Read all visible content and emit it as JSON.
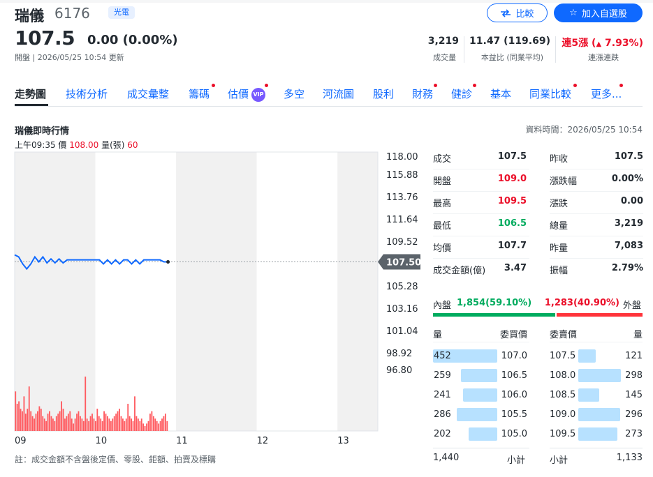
{
  "header": {
    "name": "瑞儀",
    "code": "6176",
    "sector": "光電",
    "compare_label": "比較",
    "watchlist_label": "加入自選股",
    "price": "107.5",
    "change": "0.00 (0.00%)",
    "open_status": "開盤 | 2026/05/25 10:54 更新",
    "stats": [
      {
        "value": "3,219",
        "label": "成交量"
      },
      {
        "value": "11.47 (119.69)",
        "label": "本益比 (同業平均)"
      },
      {
        "value_prefix": "連5漲",
        "value_arrow": "▲",
        "value_pct": "7.93%",
        "label": "連漲連跌"
      }
    ]
  },
  "tabs": [
    "走勢圖",
    "技術分析",
    "成交彙整",
    "籌碼",
    "估價",
    "多空",
    "河流圖",
    "股利",
    "財務",
    "健診",
    "基本",
    "同業比較",
    "更多..."
  ],
  "vip_label": "VIP",
  "section": {
    "title": "瑞儀即時行情",
    "data_time": "資料時間：2026/05/25 10:54",
    "hover_time": "上午09:35",
    "hover_price_label": "價",
    "hover_price": "108.00",
    "hover_vol_label": "量(張)",
    "hover_vol": "60"
  },
  "chart_data": {
    "type": "line",
    "y_ticks": [
      "118.00",
      "115.88",
      "113.76",
      "111.64",
      "109.52",
      "107.50",
      "105.28",
      "103.16",
      "101.04",
      "98.92",
      "96.80"
    ],
    "x_ticks": [
      "09",
      "10",
      "11",
      "12",
      "13"
    ],
    "ylim": [
      96.8,
      118.0
    ],
    "reference_price": 107.5,
    "current_label": "107.50",
    "series": [
      {
        "times": [
          9.0,
          9.05,
          9.1,
          9.15,
          9.2,
          9.25,
          9.3,
          9.35,
          9.4,
          9.45,
          9.5,
          9.55,
          9.6,
          9.65,
          9.7,
          9.75,
          9.8,
          9.85,
          9.9,
          9.95,
          10.0,
          10.05,
          10.1,
          10.15,
          10.2,
          10.25,
          10.3,
          10.35,
          10.4,
          10.45,
          10.5,
          10.55,
          10.6,
          10.65,
          10.7,
          10.75,
          10.8,
          10.85,
          10.9
        ],
        "prices": [
          108.2,
          108.0,
          107.3,
          106.8,
          107.3,
          108.0,
          107.5,
          108.0,
          107.4,
          107.8,
          107.4,
          107.8,
          107.4,
          107.7,
          107.7,
          107.7,
          107.7,
          107.7,
          107.7,
          107.7,
          107.7,
          107.7,
          107.3,
          107.7,
          107.3,
          107.7,
          107.3,
          107.7,
          107.7,
          107.3,
          107.7,
          107.3,
          107.7,
          107.7,
          107.7,
          107.7,
          107.7,
          107.5,
          107.5
        ]
      }
    ],
    "volumes": [
      80,
      55,
      60,
      45,
      40,
      70,
      35,
      45,
      90,
      40,
      30,
      25,
      35,
      40,
      50,
      45,
      30,
      25,
      20,
      35,
      40,
      30,
      25,
      20,
      30,
      35,
      40,
      60,
      45,
      25,
      30,
      35,
      40,
      25,
      15,
      25,
      35,
      40,
      30,
      25,
      20,
      110,
      25,
      20,
      30,
      35,
      25,
      20,
      45,
      30,
      25,
      20,
      40,
      35,
      30,
      25,
      20,
      25,
      30,
      35,
      40,
      45,
      30,
      25,
      20,
      25,
      55,
      30,
      25,
      20,
      70,
      30,
      25,
      20,
      25,
      15,
      10,
      15,
      20,
      35,
      40,
      30,
      25,
      20,
      15,
      20,
      25,
      30,
      35,
      20
    ]
  },
  "quote": {
    "rows": [
      [
        "成交",
        "107.5",
        "",
        "昨收",
        "107.5",
        ""
      ],
      [
        "開盤",
        "109.0",
        "red",
        "漲跌幅",
        "0.00%",
        ""
      ],
      [
        "最高",
        "109.5",
        "red",
        "漲跌",
        "0.00",
        ""
      ],
      [
        "最低",
        "106.5",
        "green",
        "總量",
        "3,219",
        ""
      ],
      [
        "均價",
        "107.7",
        "",
        "昨量",
        "7,083",
        ""
      ],
      [
        "成交金額(億)",
        "3.47",
        "",
        "振幅",
        "2.79%",
        ""
      ]
    ],
    "inner_label": "內盤",
    "inner_value": "1,854(59.10%)",
    "outer_value": "1,283(40.90%)",
    "outer_label": "外盤",
    "inner_fraction": 0.591
  },
  "orderbook": {
    "hdr_qty": "量",
    "hdr_bid": "委買價",
    "hdr_ask": "委賣價",
    "hdr_qty2": "量",
    "bids": [
      {
        "qty": "452",
        "price": "107.0",
        "frac": 1.0
      },
      {
        "qty": "259",
        "price": "106.5",
        "frac": 0.57
      },
      {
        "qty": "241",
        "price": "106.0",
        "frac": 0.53
      },
      {
        "qty": "286",
        "price": "105.5",
        "frac": 0.63
      },
      {
        "qty": "202",
        "price": "105.0",
        "frac": 0.45
      }
    ],
    "asks": [
      {
        "price": "107.5",
        "qty": "121",
        "frac": 0.41
      },
      {
        "price": "108.0",
        "qty": "298",
        "frac": 1.0
      },
      {
        "price": "108.5",
        "qty": "145",
        "frac": 0.49
      },
      {
        "price": "109.0",
        "qty": "296",
        "frac": 0.99
      },
      {
        "price": "109.5",
        "qty": "273",
        "frac": 0.92
      }
    ],
    "bid_total": "1,440",
    "subtotal_label": "小計",
    "ask_total": "1,133"
  },
  "note": "註：成交金額不含盤後定價、零股、鉅額、拍賣及標購"
}
